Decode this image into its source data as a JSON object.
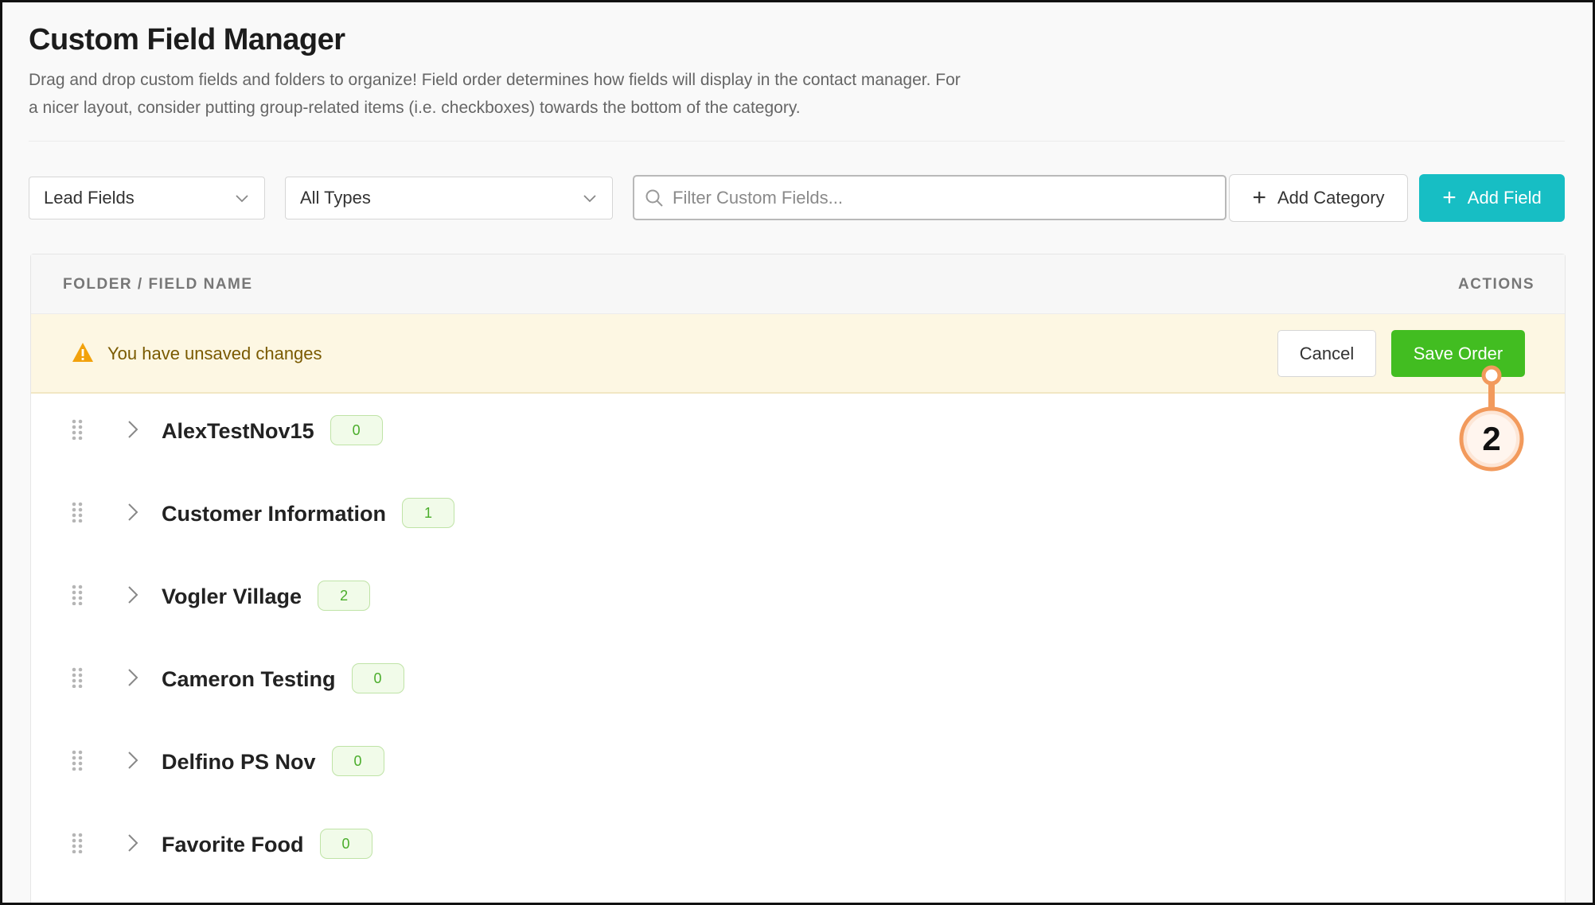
{
  "header": {
    "title": "Custom Field Manager",
    "description_line1": "Drag and drop custom fields and folders to organize! Field order determines how fields will display in the contact manager. For",
    "description_line2": "a nicer layout, consider putting group-related items (i.e. checkboxes) towards the bottom of the category."
  },
  "toolbar": {
    "field_scope": "Lead Fields",
    "type_filter": "All Types",
    "search_placeholder": "Filter Custom Fields...",
    "add_category_label": "Add Category",
    "add_field_label": "Add Field"
  },
  "table": {
    "col_name": "FOLDER / FIELD NAME",
    "col_actions": "ACTIONS"
  },
  "banner": {
    "message": "You have unsaved changes",
    "cancel_label": "Cancel",
    "save_label": "Save Order"
  },
  "folders": [
    {
      "name": "AlexTestNov15",
      "count": "0"
    },
    {
      "name": "Customer Information",
      "count": "1"
    },
    {
      "name": "Vogler Village",
      "count": "2"
    },
    {
      "name": "Cameron Testing",
      "count": "0"
    },
    {
      "name": "Delfino PS Nov",
      "count": "0"
    },
    {
      "name": "Favorite Food",
      "count": "0"
    }
  ],
  "annotation": {
    "step": "2"
  },
  "colors": {
    "accent_teal": "#17bec4",
    "save_green": "#42bd21",
    "banner_bg": "#fdf7e3",
    "warning_orange": "#f2a20c",
    "callout_orange": "#f29a5c"
  }
}
